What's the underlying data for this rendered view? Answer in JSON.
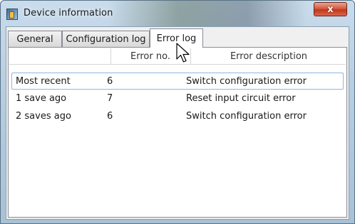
{
  "window": {
    "title": "Device information",
    "close_label": "x"
  },
  "tabs": [
    {
      "label": "General"
    },
    {
      "label": "Configuration log"
    },
    {
      "label": "Error log"
    }
  ],
  "active_tab": "Error log",
  "table": {
    "columns": [
      "",
      "Error no.",
      "Error description"
    ],
    "rows": [
      {
        "when": "Most recent",
        "error_no": "6",
        "description": "Switch configuration error"
      },
      {
        "when": "1 save ago",
        "error_no": "7",
        "description": "Reset input circuit error"
      },
      {
        "when": "2 saves ago",
        "error_no": "6",
        "description": "Switch configuration error"
      }
    ]
  },
  "icons": {
    "app": "device-app-icon",
    "cursor": "mouse-pointer-icon"
  }
}
